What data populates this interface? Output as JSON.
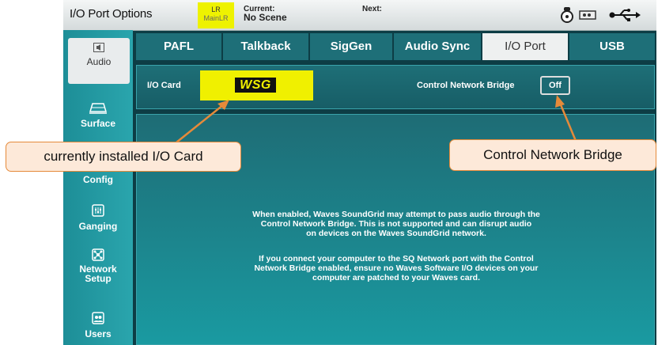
{
  "topbar": {
    "title": "I/O Port Options",
    "mix_top": "LR",
    "mix_name": "MainLR",
    "current_label": "Current:",
    "current_value": "No Scene",
    "next_label": "Next:"
  },
  "sidebar": {
    "items": [
      {
        "label": "Audio",
        "icon": "speaker-icon",
        "active": true
      },
      {
        "label": "Surface",
        "icon": "surface-icon"
      },
      {
        "label": "Config",
        "icon": "config-icon"
      },
      {
        "label": "Ganging",
        "icon": "ganging-icon"
      },
      {
        "label": "Network Setup",
        "icon": "network-icon"
      },
      {
        "label": "Users",
        "icon": "users-icon"
      }
    ]
  },
  "tabs": [
    {
      "label": "PAFL"
    },
    {
      "label": "Talkback"
    },
    {
      "label": "SigGen"
    },
    {
      "label": "Audio Sync"
    },
    {
      "label": "I/O Port",
      "active": true
    },
    {
      "label": "USB"
    }
  ],
  "io_card": {
    "label": "I/O Card",
    "card_name": "WSG"
  },
  "control_network_bridge": {
    "label": "Control Network Bridge",
    "value": "Off"
  },
  "info": {
    "paragraph1": "When enabled, Waves SoundGrid may attempt to pass audio through the\nControl Network Bridge. This is not supported and can disrupt audio\non devices on the Waves SoundGrid network.",
    "paragraph2": "If you connect your computer to the SQ Network port with the Control\nNetwork Bridge enabled, ensure no Waves Software I/O devices on your\ncomputer are patched to your Waves card."
  },
  "callouts": {
    "io_card": "currently installed I/O Card",
    "cnb": "Control Network Bridge"
  },
  "colors": {
    "accent_yellow": "#f0f000",
    "teal": "#1a9aa1",
    "callout_border": "#e58a3a",
    "callout_fill": "#fde9d9"
  }
}
